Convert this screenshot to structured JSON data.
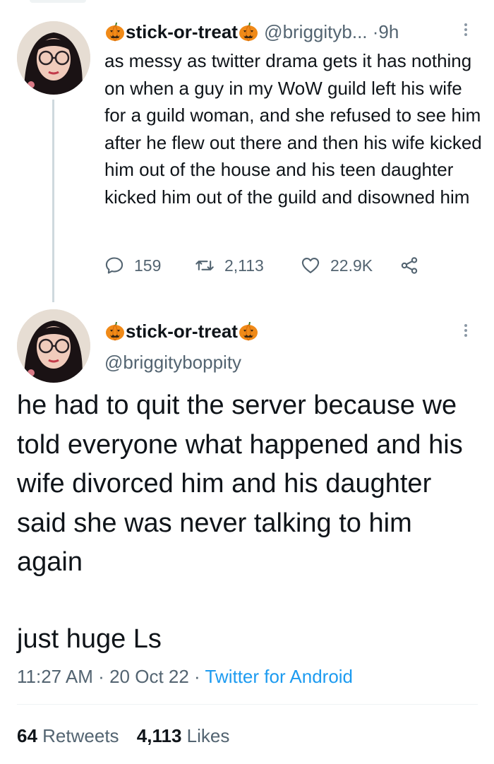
{
  "tweet1": {
    "display_name": "stick-or-treat",
    "handle": "@briggityb...",
    "separator": "·",
    "age": "9h",
    "text": "as messy as twitter drama gets it has nothing on when a guy in my WoW guild left his wife for a guild woman, and she refused to see him after he flew out there and then his wife kicked him out of the house and his teen daughter kicked him out of the guild and disowned him",
    "replies": "159",
    "retweets": "2,113",
    "likes": "22.9K"
  },
  "tweet2": {
    "display_name": "stick-or-treat",
    "handle": "@briggityboppity",
    "text": "he had to quit the server because we told everyone what happened and his wife divorced him and his daughter said she was never talking to him again",
    "text_tail": "just huge Ls",
    "time": "11:27 AM",
    "date": "20 Oct 22",
    "separator": "·",
    "source": "Twitter for Android",
    "retweet_count": "64",
    "retweet_label": "Retweets",
    "like_count": "4,113",
    "like_label": "Likes"
  },
  "colors": {
    "text": "#0f1419",
    "secondary": "#536471",
    "link": "#1d9bf0",
    "thread_line": "#cfd9de",
    "pumpkin": "#f08a18"
  },
  "icons": [
    "pumpkin-emoji",
    "reply-icon",
    "retweet-icon",
    "like-icon",
    "share-icon",
    "more-icon",
    "avatar"
  ]
}
